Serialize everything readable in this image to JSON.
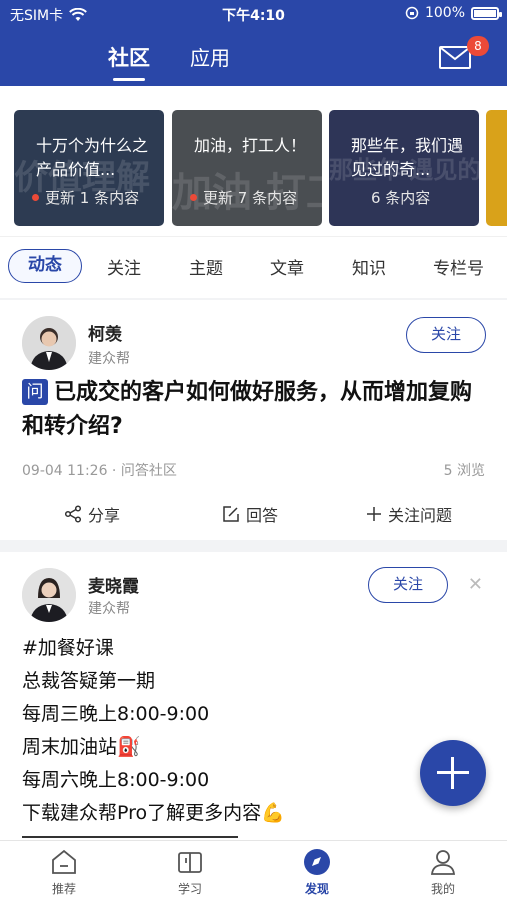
{
  "status_bar": {
    "carrier": "无SIM卡",
    "time": "下午4:10",
    "battery": "100%"
  },
  "header": {
    "tabs": [
      {
        "label": "社区",
        "active": true
      },
      {
        "label": "应用",
        "active": false
      }
    ],
    "mail_badge": "8"
  },
  "banners": [
    {
      "title": "十万个为什么之产品价值...",
      "meta": "更新 1 条内容",
      "has_dot": true,
      "bg_text": "价值理解"
    },
    {
      "title": "加油，打工人！",
      "meta": "更新 7 条内容",
      "has_dot": true,
      "bg_text": "加油 打工人"
    },
    {
      "title": "那些年，我们遇见过的奇...",
      "meta": "6 条内容",
      "has_dot": false,
      "bg_text": "那些年 遇见的奇葩客"
    }
  ],
  "filters": [
    "动态",
    "关注",
    "主题",
    "文章",
    "知识",
    "专栏号"
  ],
  "post1": {
    "author": "柯羡",
    "org": "建众帮",
    "follow": "关注",
    "q_mark": "问",
    "title": "已成交的客户如何做好服务，从而增加复购和转介绍?",
    "meta": "09-04 11:26 · 问答社区",
    "views": "5 浏览",
    "actions": {
      "share": "分享",
      "answer": "回答",
      "follow_q": "关注问题"
    }
  },
  "post2": {
    "author": "麦晓霞",
    "org": "建众帮",
    "follow": "关注",
    "lines": [
      "#加餐好课",
      "总裁答疑第一期",
      "每周三晚上8:00-9:00",
      "周末加油站⛽",
      "每周六晚上8:00-9:00",
      "下载建众帮Pro了解更多内容💪"
    ]
  },
  "bottom_nav": [
    {
      "label": "推荐",
      "icon": "home-icon"
    },
    {
      "label": "学习",
      "icon": "book-icon"
    },
    {
      "label": "发现",
      "icon": "compass-icon",
      "active": true
    },
    {
      "label": "我的",
      "icon": "user-icon"
    }
  ],
  "colors": {
    "brand": "#2a47a8",
    "badge": "#ec4a38"
  }
}
